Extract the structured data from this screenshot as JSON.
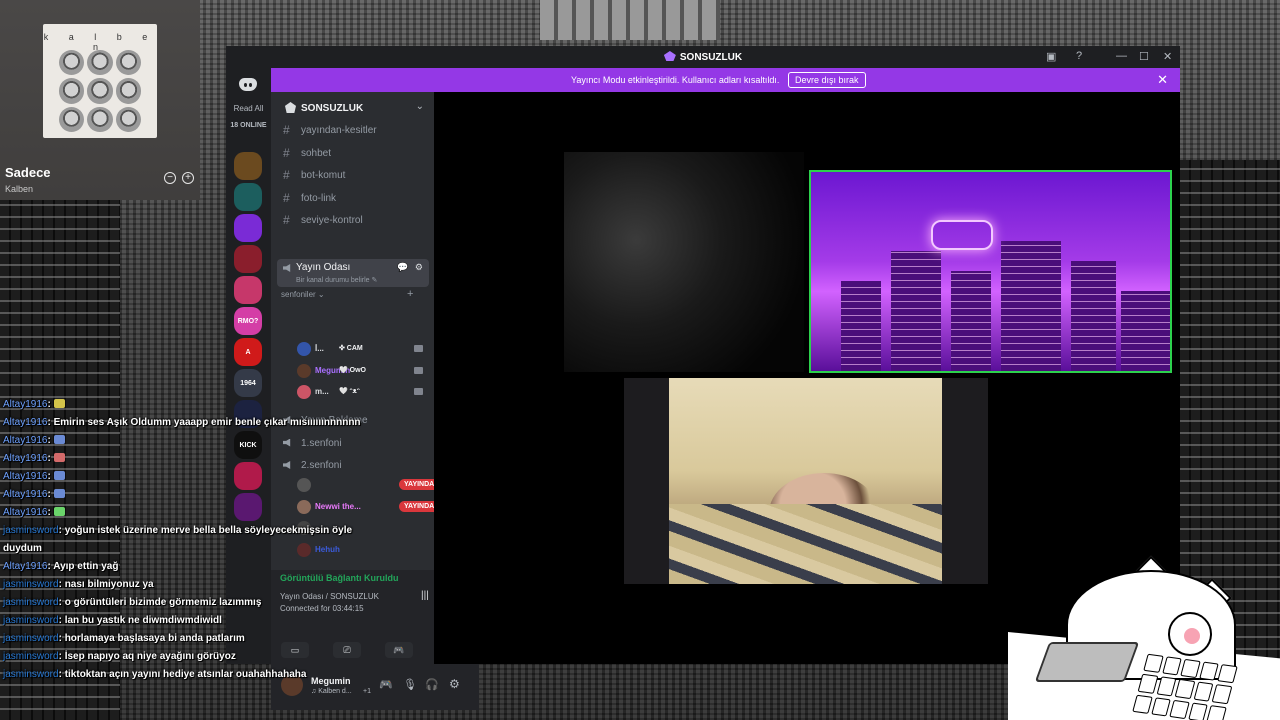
{
  "spotify": {
    "album_artist_caps": "k a l b e n",
    "track": "Sadece",
    "artist": "Kalben",
    "minus": "⊖",
    "plus": "⊕"
  },
  "window": {
    "title": "SONSUZLUK",
    "controls": [
      "▣",
      "?",
      "—",
      "☐",
      "✕"
    ]
  },
  "notice": {
    "text": "Yayıncı Modu etkinleştirildi. Kullanıcı adları kısaltıldı.",
    "button": "Devre dışı bırak",
    "close": "✕"
  },
  "servers": {
    "read_all": "Read All",
    "online": "18 ONLINE",
    "icons": [
      {
        "label": "",
        "color": "#6b4a1f"
      },
      {
        "label": "",
        "color": "#1c5e5e"
      },
      {
        "label": "",
        "color": "#7a2bd6"
      },
      {
        "label": "",
        "color": "#8a1e2c"
      },
      {
        "label": "",
        "color": "#c6376a"
      },
      {
        "label": "RMO?",
        "color": "#d43ea6"
      },
      {
        "label": "A",
        "color": "#d01a1a"
      },
      {
        "label": "1964",
        "color": "#343a48"
      },
      {
        "label": "",
        "color": "#1c2240"
      },
      {
        "label": "KICK",
        "color": "#0f0f0f"
      },
      {
        "label": "",
        "color": "#b01a4a"
      },
      {
        "label": "",
        "color": "#5a1870"
      }
    ]
  },
  "guild": {
    "name": "SONSUZLUK",
    "chevron": "⌄",
    "text_channels": [
      "yayından-kesitler",
      "sohbet",
      "bot-komut",
      "foto-link",
      "seviye-kontrol"
    ],
    "category": "senfoniler",
    "category_chevron": "⌄",
    "category_plus": "+",
    "active_voice": {
      "name": "Yayın Odası",
      "status": "Bir kanal durumu belirle ✎",
      "icons": "💬 ⚙"
    },
    "voice_members_1": [
      {
        "name": "İ...",
        "tag": "✜ CAM",
        "name_color": "#dbdee1",
        "avatar": "#3355aa"
      },
      {
        "name": "Megumin",
        "tag": "🤍 OwO",
        "name_color": "#a970ff",
        "avatar": "#5a3a2a"
      },
      {
        "name": "m...",
        "tag": "🤍 ᵔᴥᵔ",
        "name_color": "#dbdee1",
        "avatar": "#cc5566"
      }
    ],
    "voice_channels": [
      "Yayın Bekleme",
      "1.senfoni",
      "2.senfoni"
    ],
    "voice_members_2": [
      {
        "name": "",
        "live": "YAYINDA",
        "name_color": "#dbdee1",
        "avatar": "#555"
      },
      {
        "name": "Newwi the...",
        "live": "YAYINDA",
        "name_color": "#e879f9",
        "avatar": "#8a6a5a"
      },
      {
        "name": "",
        "live": "",
        "name_color": "#8a1e2c",
        "avatar": "#444"
      },
      {
        "name": "Hehuh",
        "live": "",
        "name_color": "#3b5bdb",
        "avatar": "#5a2a2a"
      }
    ]
  },
  "voice_panel": {
    "connected": "Görüntülü Bağlantı Kuruldu",
    "room": "Yayın Odası / SONSUZLUK",
    "time": "Connected for 03:44:15"
  },
  "user_panel": {
    "name": "Megumin",
    "status": "♫ Kalben d...",
    "extra": "+1"
  },
  "chat": [
    {
      "user": "Altay1916",
      "msg": "",
      "emote": "#d4c44a"
    },
    {
      "user": "Altay1916",
      "msg": "Emirin ses Aşık Oldumm yaaapp emir benle çıkar mısıııııınnnnnn",
      "emote": ""
    },
    {
      "user": "Altay1916",
      "msg": "",
      "emote": "#6a8ad4"
    },
    {
      "user": "Altay1916",
      "msg": "",
      "emote": "#d46a6a"
    },
    {
      "user": "Altay1916",
      "msg": "",
      "emote": "#6a8ad4"
    },
    {
      "user": "Altay1916",
      "msg": "",
      "emote": "#6a8ad4"
    },
    {
      "user": "Altay1916",
      "msg": "",
      "emote": "#6ad46a"
    },
    {
      "user": "jasminsword",
      "msg": "yoğun istek üzerine merve bella bella söyleyecekmişsin öyle",
      "emote": ""
    },
    {
      "user": "",
      "msg": "duydum",
      "emote": ""
    },
    {
      "user": "Altay1916",
      "msg": "Ayıp ettin yağ",
      "emote": ""
    },
    {
      "user": "jasminsword",
      "msg": "nası bilmiyonuz ya",
      "emote": ""
    },
    {
      "user": "jasminsword",
      "msg": "o görüntüleri bizimde görmemiz lazımmış",
      "emote": ""
    },
    {
      "user": "jasminsword",
      "msg": "lan bu yastık ne diwmdiwmdiwidl",
      "emote": ""
    },
    {
      "user": "jasminsword",
      "msg": "horlamaya başlasaya bi anda patlarım",
      "emote": ""
    },
    {
      "user": "jasminsword",
      "msg": "İsep napıyo aq niye ayağını görüyoz",
      "emote": ""
    },
    {
      "user": "jasminsword",
      "msg": "tiktoktan açın yayını hediye atsınlar ouahahhahaha",
      "emote": ""
    }
  ]
}
